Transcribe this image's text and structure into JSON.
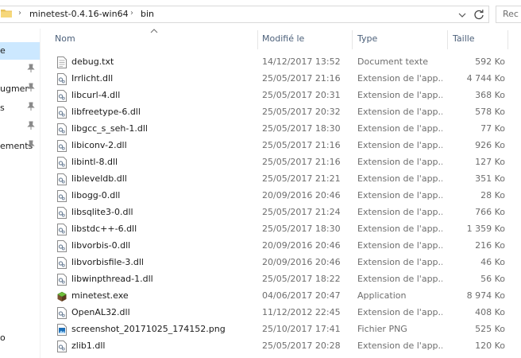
{
  "address": {
    "crumbs": [
      "minetest-0.4.16-win64",
      "bin"
    ],
    "search_placeholder": "Rec"
  },
  "nav": {
    "items": [
      {
        "label": "e",
        "selected": true,
        "pinned": false
      },
      {
        "label": "",
        "selected": false,
        "pinned": true
      },
      {
        "label": "ugmer",
        "selected": false,
        "pinned": true
      },
      {
        "label": "s",
        "selected": false,
        "pinned": true
      },
      {
        "label": "",
        "selected": false,
        "pinned": true
      },
      {
        "label": "ements",
        "selected": false,
        "pinned": true
      }
    ],
    "bottom_label": "o"
  },
  "columns": {
    "name": "Nom",
    "modified": "Modifié le",
    "type": "Type",
    "size": "Taille"
  },
  "files": [
    {
      "name": "debug.txt",
      "date": "14/12/2017 13:52",
      "type": "Document texte",
      "size": "592 Ko",
      "icon": "text-file-icon"
    },
    {
      "name": "Irrlicht.dll",
      "date": "25/05/2017 21:16",
      "type": "Extension de l'app...",
      "size": "4 744 Ko",
      "icon": "dll-file-icon"
    },
    {
      "name": "libcurl-4.dll",
      "date": "25/05/2017 20:31",
      "type": "Extension de l'app...",
      "size": "368 Ko",
      "icon": "dll-file-icon"
    },
    {
      "name": "libfreetype-6.dll",
      "date": "25/05/2017 20:32",
      "type": "Extension de l'app...",
      "size": "578 Ko",
      "icon": "dll-file-icon"
    },
    {
      "name": "libgcc_s_seh-1.dll",
      "date": "25/05/2017 18:30",
      "type": "Extension de l'app...",
      "size": "77 Ko",
      "icon": "dll-file-icon"
    },
    {
      "name": "libiconv-2.dll",
      "date": "25/05/2017 21:16",
      "type": "Extension de l'app...",
      "size": "926 Ko",
      "icon": "dll-file-icon"
    },
    {
      "name": "libintl-8.dll",
      "date": "25/05/2017 21:16",
      "type": "Extension de l'app...",
      "size": "127 Ko",
      "icon": "dll-file-icon"
    },
    {
      "name": "libleveldb.dll",
      "date": "25/05/2017 21:21",
      "type": "Extension de l'app...",
      "size": "351 Ko",
      "icon": "dll-file-icon"
    },
    {
      "name": "libogg-0.dll",
      "date": "20/09/2016 20:46",
      "type": "Extension de l'app...",
      "size": "28 Ko",
      "icon": "dll-file-icon"
    },
    {
      "name": "libsqlite3-0.dll",
      "date": "25/05/2017 21:24",
      "type": "Extension de l'app...",
      "size": "766 Ko",
      "icon": "dll-file-icon"
    },
    {
      "name": "libstdc++-6.dll",
      "date": "25/05/2017 18:30",
      "type": "Extension de l'app...",
      "size": "1 359 Ko",
      "icon": "dll-file-icon"
    },
    {
      "name": "libvorbis-0.dll",
      "date": "20/09/2016 20:46",
      "type": "Extension de l'app...",
      "size": "216 Ko",
      "icon": "dll-file-icon"
    },
    {
      "name": "libvorbisfile-3.dll",
      "date": "20/09/2016 20:46",
      "type": "Extension de l'app...",
      "size": "46 Ko",
      "icon": "dll-file-icon"
    },
    {
      "name": "libwinpthread-1.dll",
      "date": "25/05/2017 18:22",
      "type": "Extension de l'app...",
      "size": "56 Ko",
      "icon": "dll-file-icon"
    },
    {
      "name": "minetest.exe",
      "date": "04/06/2017 20:47",
      "type": "Application",
      "size": "8 974 Ko",
      "icon": "minetest-app-icon"
    },
    {
      "name": "OpenAL32.dll",
      "date": "11/12/2012 22:45",
      "type": "Extension de l'app...",
      "size": "408 Ko",
      "icon": "dll-file-icon"
    },
    {
      "name": "screenshot_20171025_174152.png",
      "date": "25/10/2017 17:41",
      "type": "Fichier PNG",
      "size": "525 Ko",
      "icon": "png-file-icon"
    },
    {
      "name": "zlib1.dll",
      "date": "25/05/2017 20:28",
      "type": "Extension de l'app...",
      "size": "120 Ko",
      "icon": "dll-file-icon"
    }
  ]
}
